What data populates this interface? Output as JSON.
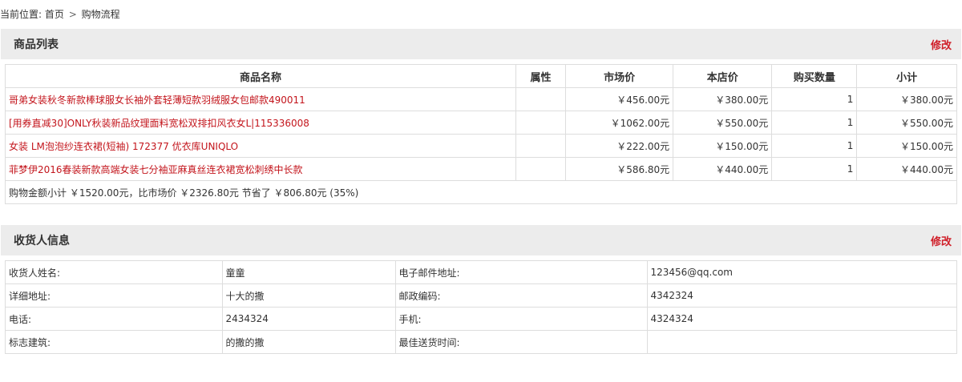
{
  "breadcrumb": {
    "prefix": "当前位置:",
    "home": "首页",
    "separator": ">",
    "current": "购物流程"
  },
  "goods_section": {
    "title": "商品列表",
    "edit_label": "修改",
    "columns": [
      "商品名称",
      "属性",
      "市场价",
      "本店价",
      "购买数量",
      "小计"
    ],
    "rows": [
      {
        "name": "哥弟女装秋冬新款棒球服女长袖外套轻薄短款羽绒服女包邮款490011",
        "attr": "",
        "market_price": "￥456.00元",
        "shop_price": "￥380.00元",
        "qty": "1",
        "subtotal": "￥380.00元"
      },
      {
        "name": "[用券直减30]ONLY秋装新品纹理面料宽松双排扣风衣女L|115336008",
        "attr": "",
        "market_price": "￥1062.00元",
        "shop_price": "￥550.00元",
        "qty": "1",
        "subtotal": "￥550.00元"
      },
      {
        "name": "女装 LM泡泡纱连衣裙(短袖) 172377 优衣库UNIQLO",
        "attr": "",
        "market_price": "￥222.00元",
        "shop_price": "￥150.00元",
        "qty": "1",
        "subtotal": "￥150.00元"
      },
      {
        "name": "菲梦伊2016春装新款高端女装七分袖亚麻真丝连衣裙宽松刺绣中长款",
        "attr": "",
        "market_price": "￥586.80元",
        "shop_price": "￥440.00元",
        "qty": "1",
        "subtotal": "￥440.00元"
      }
    ],
    "summary": "购物金额小计 ￥1520.00元，比市场价 ￥2326.80元 节省了 ￥806.80元 (35%)"
  },
  "consignee_section": {
    "title": "收货人信息",
    "edit_label": "修改",
    "rows": [
      {
        "label1": "收货人姓名:",
        "value1": "童童",
        "label2": "电子邮件地址:",
        "value2": "123456@qq.com"
      },
      {
        "label1": "详细地址:",
        "value1": "十大的撒",
        "label2": "邮政编码:",
        "value2": "4342324"
      },
      {
        "label1": "电话:",
        "value1": "2434324",
        "label2": "手机:",
        "value2": "4324324"
      },
      {
        "label1": "标志建筑:",
        "value1": "的撒的撒",
        "label2": "最佳送货时间:",
        "value2": ""
      }
    ]
  },
  "colors": {
    "accent": "#d0202a",
    "goods_link": "#c3151c",
    "header_bg": "#ececec",
    "border": "#dddddd"
  }
}
